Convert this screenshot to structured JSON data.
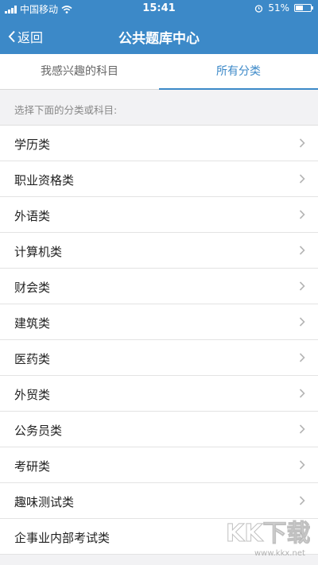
{
  "status": {
    "carrier": "中国移动",
    "time": "15:41",
    "battery": "51%",
    "battery_level": 0.51
  },
  "nav": {
    "back_label": "返回",
    "title": "公共题库中心"
  },
  "tabs": [
    {
      "label": "我感兴趣的科目",
      "active": false
    },
    {
      "label": "所有分类",
      "active": true
    }
  ],
  "hint": "选择下面的分类或科目:",
  "categories": [
    "学历类",
    "职业资格类",
    "外语类",
    "计算机类",
    "财会类",
    "建筑类",
    "医药类",
    "外贸类",
    "公务员类",
    "考研类",
    "趣味测试类",
    "企事业内部考试类"
  ],
  "watermark": {
    "text": "www.kkx.net",
    "logo_text": "KK下载"
  },
  "colors": {
    "brand": "#3c89c8",
    "background": "#f2f2f4"
  }
}
